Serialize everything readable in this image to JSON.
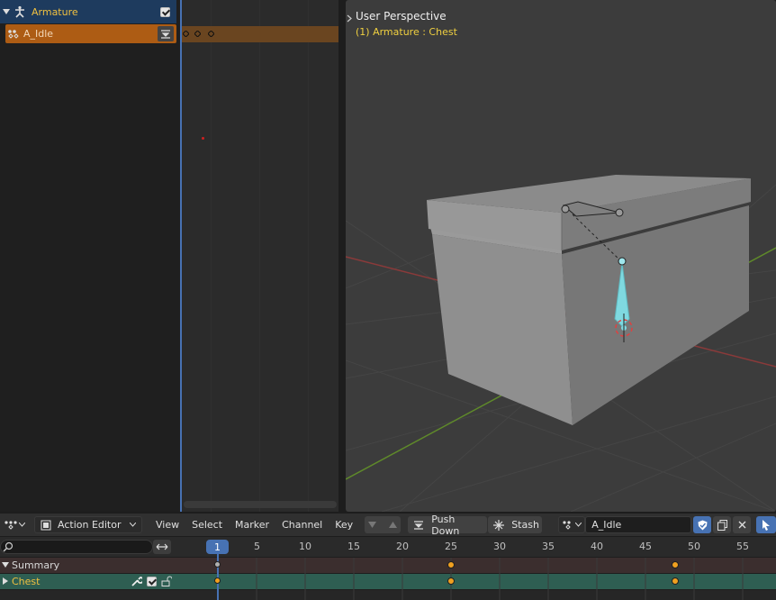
{
  "nla": {
    "armature_label": "Armature",
    "action_label": "A_Idle"
  },
  "viewport": {
    "title": "User Perspective",
    "subtitle": "(1) Armature : Chest"
  },
  "header": {
    "editor_label": "Action Editor",
    "menus": [
      "View",
      "Select",
      "Marker",
      "Channel",
      "Key"
    ],
    "push_down_label": "Push Down",
    "stash_label": "Stash",
    "action_name": "A_Idle"
  },
  "timeline": {
    "current_frame": "1",
    "ticks": [
      "5",
      "10",
      "15",
      "20",
      "25",
      "30",
      "35",
      "40",
      "45",
      "50",
      "55"
    ],
    "channels": {
      "summary_label": "Summary",
      "chest_label": "Chest"
    },
    "keyframes": [
      1,
      25,
      48
    ]
  },
  "colors": {
    "accent": "#4772b3",
    "keyframe": "#f0a020",
    "bone_selected": "#7fd9e0",
    "action_strip": "#ad5c14"
  }
}
